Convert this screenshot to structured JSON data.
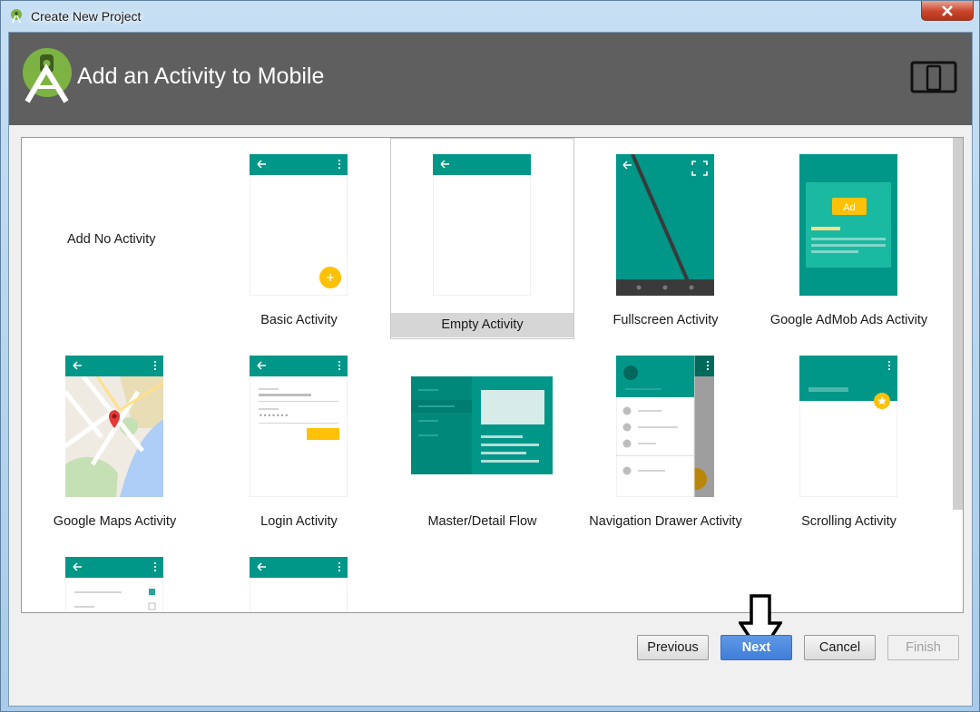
{
  "window": {
    "title": "Create New Project",
    "close_label": "✕"
  },
  "header": {
    "title": "Add an Activity to Mobile"
  },
  "gallery": {
    "no_activity": "Add No Activity",
    "items": [
      {
        "label": "Basic Activity"
      },
      {
        "label": "Empty Activity",
        "selected": true
      },
      {
        "label": "Fullscreen Activity"
      },
      {
        "label": "Google AdMob Ads Activity",
        "ad_badge": "Ad"
      },
      {
        "label": "Google Maps Activity"
      },
      {
        "label": "Login Activity"
      },
      {
        "label": "Master/Detail Flow"
      },
      {
        "label": "Navigation Drawer Activity"
      },
      {
        "label": "Scrolling Activity"
      }
    ]
  },
  "buttons": {
    "previous": "Previous",
    "next": "Next",
    "cancel": "Cancel",
    "finish": "Finish"
  },
  "colors": {
    "teal": "#009688",
    "teal_dark": "#00796b",
    "accent": "#ffc107",
    "header_bg": "#5f5f5f",
    "next_bg": "#4a87df"
  }
}
